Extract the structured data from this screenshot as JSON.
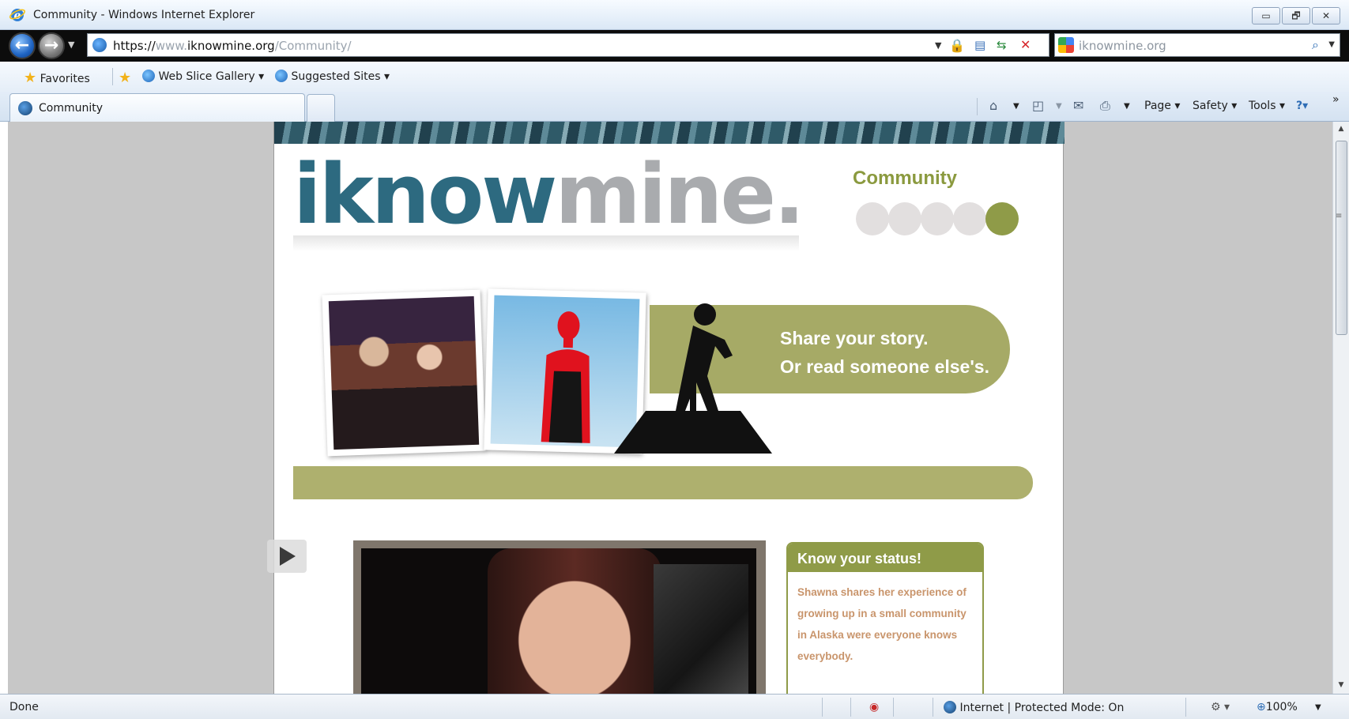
{
  "window": {
    "title": "Community - Windows Internet Explorer",
    "buttons": {
      "minimize": "▭",
      "restore": "🗗",
      "close": "✕"
    }
  },
  "address_bar": {
    "url_scheme": "https://",
    "url_prefix": "www.",
    "url_domain": "iknowmine.org",
    "url_path": "/Community/",
    "search_placeholder": "iknowmine.org"
  },
  "favorites_bar": {
    "favorites_label": "Favorites",
    "web_slice_label": "Web Slice Gallery",
    "suggested_label": "Suggested Sites"
  },
  "tabs": {
    "active_label": "Community"
  },
  "command_bar": {
    "page": "Page",
    "safety": "Safety",
    "tools": "Tools",
    "overflow": "»"
  },
  "page": {
    "logo_part1": "iknow",
    "logo_part2": "mine.",
    "section_label": "Community",
    "section_dots_total": 5,
    "section_dots_active": 5,
    "hero_line1": "Share your story.",
    "hero_line2": "Or read someone else's.",
    "status_box": {
      "title": "Know your status!",
      "text": "Shawna shares her experience of growing up in a small community in Alaska were everyone knows everybody."
    }
  },
  "status_bar": {
    "left_text": "Done",
    "zone_text": "Internet | Protected Mode: On",
    "zoom": "100%"
  },
  "colors": {
    "logo_blue": "#2d6a80",
    "logo_grey": "#a9abae",
    "olive": "#8f9b48",
    "status_text": "#c9956c"
  }
}
